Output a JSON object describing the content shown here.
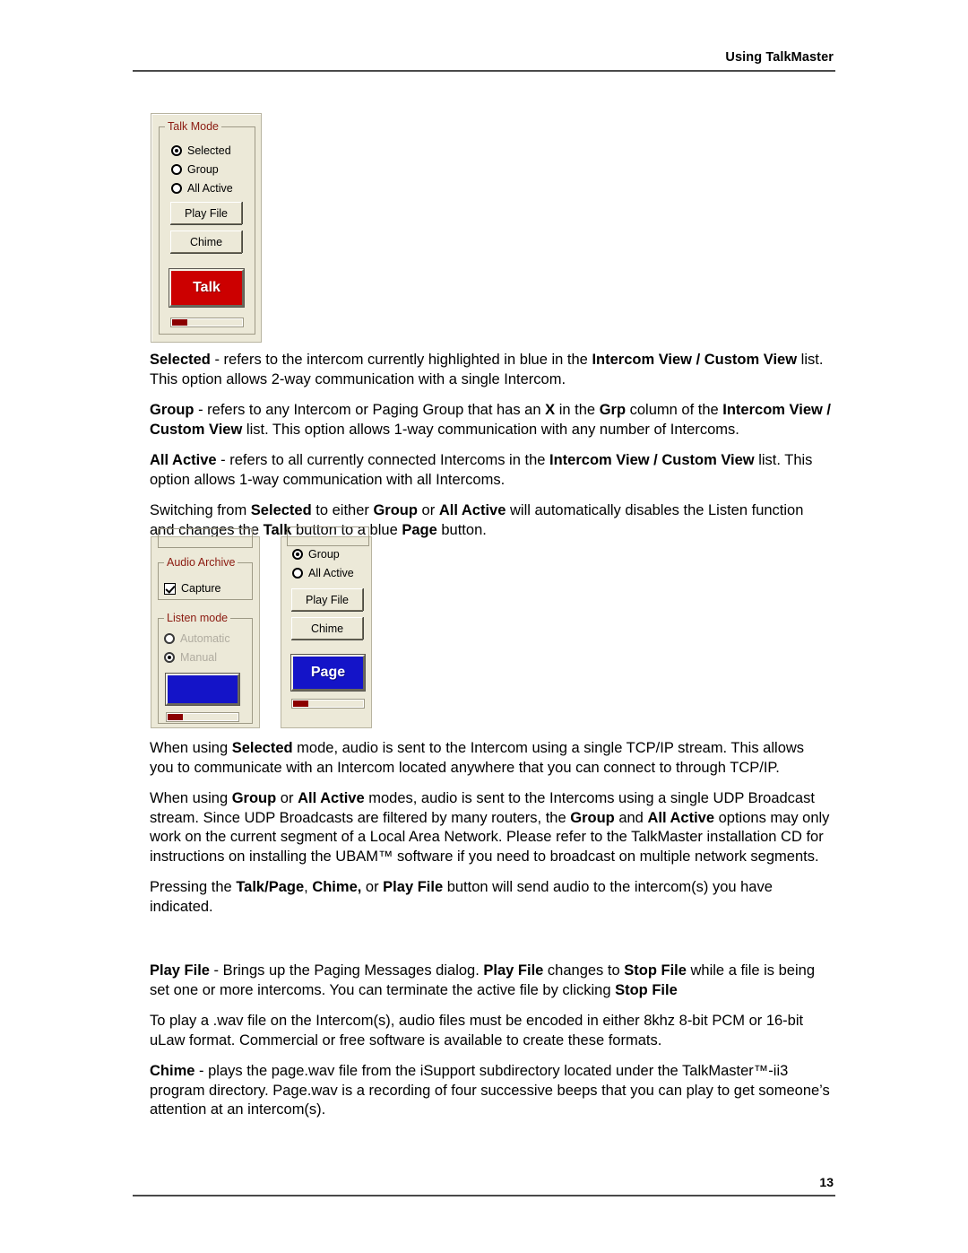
{
  "header": {
    "title": "Using TalkMaster"
  },
  "footer": {
    "page_number": "13"
  },
  "figure_talk_mode": {
    "groupbox_label": "Talk Mode",
    "radios": [
      {
        "label": "Selected",
        "selected": true
      },
      {
        "label": "Group",
        "selected": false
      },
      {
        "label": "All Active",
        "selected": false
      }
    ],
    "buttons": [
      {
        "label": "Play File"
      },
      {
        "label": "Chime"
      }
    ],
    "main_button": {
      "label": "Talk",
      "color": "#CC0000"
    },
    "vu_meter": {
      "fill_percent": 22,
      "fill_color": "#8B0000"
    }
  },
  "figure_page_mode": {
    "left_panel": {
      "audio_archive": {
        "groupbox_label": "Audio Archive",
        "checkbox_label": "Capture",
        "checked": true
      },
      "listen_mode": {
        "groupbox_label": "Listen mode",
        "radios": [
          {
            "label": "Automatic",
            "selected": false,
            "disabled": true
          },
          {
            "label": "Manual",
            "selected": true,
            "disabled": true
          }
        ]
      },
      "main_button": {
        "label": "",
        "color": "#1414C8"
      },
      "vu_meter": {
        "fill_percent": 22,
        "fill_color": "#8B0000"
      }
    },
    "right_panel": {
      "radios": [
        {
          "label": "Group",
          "selected": true
        },
        {
          "label": "All Active",
          "selected": false
        }
      ],
      "buttons": [
        {
          "label": "Play File"
        },
        {
          "label": "Chime"
        }
      ],
      "main_button": {
        "label": "Page",
        "color": "#1414C8"
      },
      "vu_meter": {
        "fill_percent": 22,
        "fill_color": "#8B0000"
      }
    }
  },
  "body": {
    "para_selected": {
      "b1": "Selected",
      "t1": " - refers to the intercom currently highlighted in blue in the ",
      "b2": "Intercom View / Custom View",
      "t2": " list. This option allows 2-way communication with a single Intercom."
    },
    "para_group": {
      "b1": "Group",
      "t1": " - refers to any Intercom or Paging Group that has an ",
      "b2": "X",
      "t2": " in the ",
      "b3": "Grp",
      "t3": " column of the ",
      "b4": "Intercom View / Custom View",
      "t4": " list. This option allows 1-way communication with any number of Intercoms."
    },
    "para_all_active": {
      "b1": "All Active",
      "t1": " - refers to all currently connected Intercoms in the ",
      "b2": "Intercom View / Custom View",
      "t2": " list.  This option allows 1-way communication with all Intercoms."
    },
    "para_switching": {
      "t1": "Switching from ",
      "b1": "Selected",
      "t2": " to either ",
      "b2": "Group",
      "t3": " or ",
      "b3": "All Active",
      "t4": " will automatically disables the Listen function and changes the ",
      "b4": "Talk",
      "t5": " button to a blue ",
      "b5": "Page",
      "t6": " button."
    },
    "para_tcpip": {
      "t1": "When using ",
      "b1": "Selected",
      "t2": " mode, audio is sent to the Intercom using a single TCP/IP stream.  This allows you to communicate with an Intercom located anywhere that you can connect to through TCP/IP."
    },
    "para_udp": {
      "t1": "When using ",
      "b1": "Group",
      "t2": " or ",
      "b2": "All Active",
      "t3": " modes, audio is sent to the Intercoms using a single UDP Broadcast stream.  Since UDP Broadcasts are filtered by many routers, the ",
      "b3": "Group",
      "t4": " and ",
      "b4": "All Active",
      "t5": " options may only work on the current segment of a Local Area Network.  Please refer to the TalkMaster installation CD for instructions on installing the UBAM™ software if you need to broadcast on multiple network segments."
    },
    "para_pressing": {
      "t1": "Pressing the ",
      "b1": "Talk/Page",
      "t2": ", ",
      "b2": "Chime,",
      "t3": " or ",
      "b3": "Play File",
      "t4": " button will send audio to the intercom(s) you have indicated."
    },
    "para_playfile": {
      "b1": "Play File",
      "t1": " - Brings up the Paging Messages dialog.  ",
      "b2": "Play File",
      "t2": " changes to ",
      "b3": "Stop File",
      "t3": " while a file is being set one or more intercoms.  You can terminate the active file by clicking ",
      "b4": "Stop File"
    },
    "para_wav": {
      "t1": "To play a .wav file on the Intercom(s), audio files must be encoded in either 8khz 8-bit PCM or 16-bit uLaw format.  Commercial or free software is available to create these formats."
    },
    "para_chime": {
      "b1": "Chime",
      "t1": " - plays the page.wav file from the iSupport subdirectory located under the TalkMaster™-ii3 program directory. Page.wav is a recording of four successive beeps that you can play to get someone’s attention at an intercom(s)."
    }
  }
}
